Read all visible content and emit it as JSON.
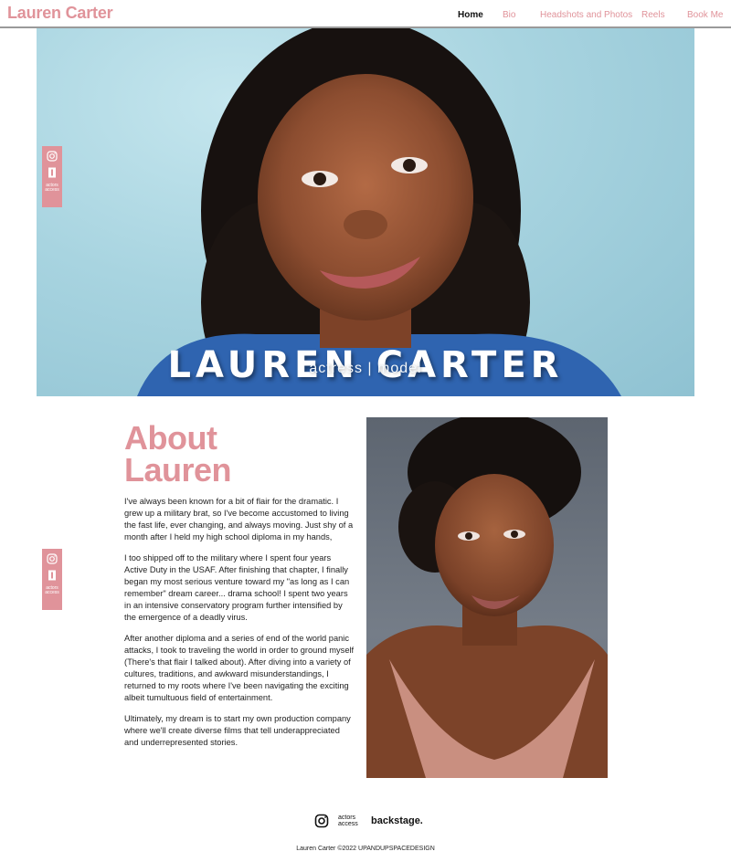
{
  "header": {
    "logo": "Lauren Carter",
    "nav": [
      {
        "label": "Home",
        "active": true
      },
      {
        "label": "Bio",
        "active": false
      },
      {
        "label": "Headshots and Photos",
        "active": false
      },
      {
        "label": "Reels",
        "active": false
      },
      {
        "label": "Book Me",
        "active": false
      }
    ]
  },
  "hero": {
    "name": "LAUREN CARTER",
    "subtitle": "actress | model"
  },
  "side_bar": {
    "icons": [
      "instagram-icon",
      "imdb-icon",
      "actors-access-icon"
    ],
    "actors_access_label": "actors access"
  },
  "about": {
    "title_line1": "About",
    "title_line2": "Lauren",
    "paragraphs": [
      "I've always been known for a bit of flair for the dramatic. I grew up a military brat, so I've become accustomed to living the fast life, ever changing, and always moving. Just shy of a month after I held my high school diploma in my hands,",
      "I too shipped off to the military where I spent four years Active Duty in the USAF. After finishing that chapter, I finally began my most serious venture toward my \"as long as I can remember\" dream career... drama school! I spent two years in an intensive conservatory program further intensified by the emergence of a deadly virus.",
      "After another diploma and a series of end of the world panic attacks, I took to traveling the world in order to ground myself (There's that flair I talked about). After diving into a variety of cultures, traditions, and awkward misunderstandings, I returned to my roots where I've been navigating the exciting albeit tumultuous field of entertainment.",
      "Ultimately, my dream is to start my own production company where we'll create diverse films that tell underappreciated and underrepresented stories."
    ]
  },
  "footer": {
    "actors_access_label": "actors access",
    "backstage_label": "backstage.",
    "copyright": "Lauren Carter ©2022 UPANDUPSPACEDESIGN"
  },
  "colors": {
    "accent": "#e0939a",
    "hero_bg": "#a8d4e0"
  }
}
